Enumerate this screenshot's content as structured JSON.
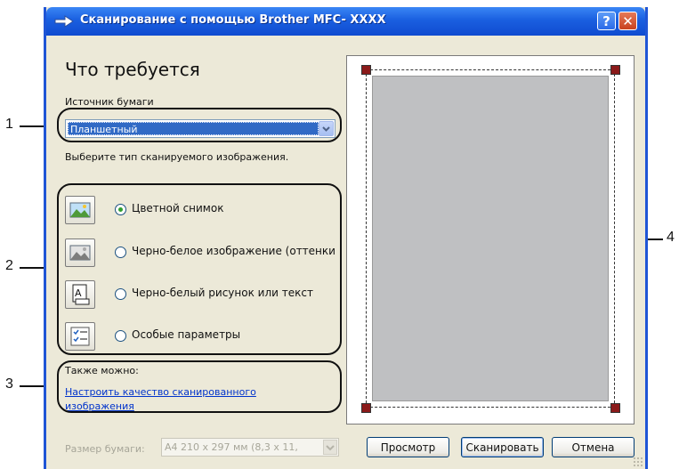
{
  "window": {
    "title": "Сканирование с помощью Brother MFC- XXXX",
    "help_label": "?",
    "close_label": "✕"
  },
  "main": {
    "heading": "Что требуется",
    "source_label": "Источник бумаги",
    "source_value": "Планшетный",
    "image_type_label": "Выберите тип сканируемого изображения.",
    "image_types": [
      {
        "label": "Цветной снимок",
        "selected": true,
        "icon": "color-photo-icon"
      },
      {
        "label": "Черно-белое изображение (оттенки",
        "selected": false,
        "icon": "grayscale-photo-icon"
      },
      {
        "label": "Черно-белый рисунок или текст",
        "selected": false,
        "icon": "bw-text-icon"
      },
      {
        "label": "Особые параметры",
        "selected": false,
        "icon": "custom-settings-icon"
      }
    ],
    "also_label": "Также можно:",
    "adjust_link": "Настроить качество сканированного изображения",
    "paper_size_label": "Размер бумаги:",
    "paper_size_value": "A4 210 x 297 мм (8,3 x 11,"
  },
  "buttons": {
    "preview": "Просмотр",
    "scan": "Сканировать",
    "cancel": "Отмена"
  },
  "callouts": [
    "1",
    "2",
    "3",
    "4"
  ],
  "colors": {
    "titlebar": "#1a5fe0",
    "dialog_bg": "#ece9d8",
    "selection": "#316ac5",
    "link": "#0033cc",
    "scan_handles": "#8b1a1a",
    "scan_area": "#bfc0c2"
  }
}
